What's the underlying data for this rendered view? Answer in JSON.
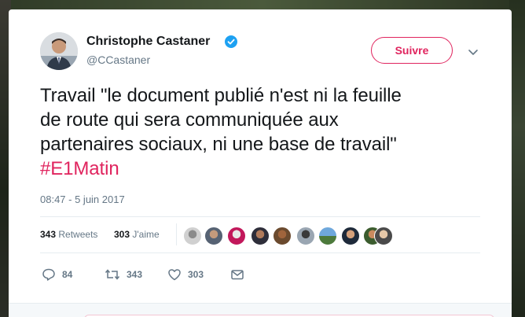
{
  "tweet": {
    "author_name": "Christophe Castaner",
    "author_handle": "@CCastaner",
    "follow_label": "Suivre",
    "text_lines": [
      "Travail \"le document publié n'est ni la feuille",
      "de route qui sera communiquée aux",
      "partenaires sociaux, ni une base de travail\""
    ],
    "hashtag": "#E1Matin",
    "timestamp": "08:47 - 5 juin 2017",
    "retweets_count": "343",
    "retweets_label": "Retweets",
    "likes_count": "303",
    "likes_label": "J'aime",
    "likers": [
      "liker-1",
      "liker-2",
      "liker-3",
      "liker-4",
      "liker-5",
      "liker-6",
      "liker-7",
      "liker-8",
      "liker-9",
      "liker-10"
    ],
    "actions": {
      "reply_count": "84",
      "retweet_count": "343",
      "like_count": "303"
    }
  },
  "icons": {
    "verified": "verified-badge-icon",
    "caret": "chevron-down-icon",
    "reply": "reply-icon",
    "retweet": "retweet-icon",
    "like": "heart-icon",
    "message": "envelope-icon"
  },
  "colors": {
    "accent": "#e0245e",
    "verified": "#1da1f2",
    "muted": "#657786",
    "text": "#14171a"
  }
}
